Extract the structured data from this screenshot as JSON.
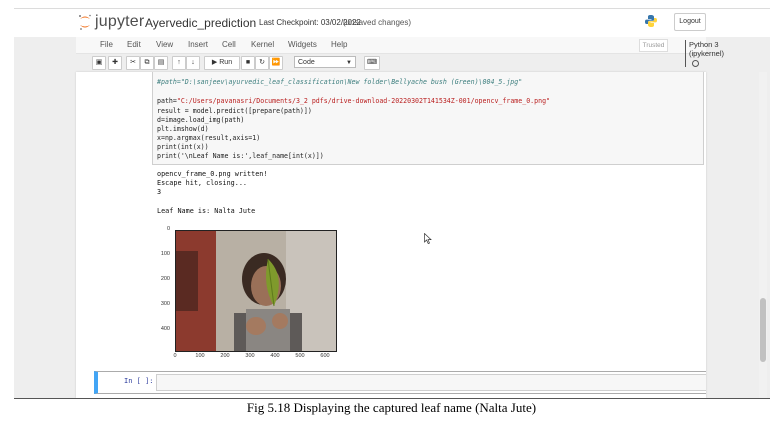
{
  "header": {
    "logo_text": "jupyter",
    "notebook_name": "Ayervedic_prediction",
    "checkpoint": "Last Checkpoint: 03/02/2022",
    "unsaved": "(unsaved changes)",
    "logout_label": "Logout"
  },
  "menu": {
    "items": [
      "File",
      "Edit",
      "View",
      "Insert",
      "Cell",
      "Kernel",
      "Widgets",
      "Help"
    ],
    "trusted": "Trusted",
    "kernel": "Python 3 (ipykernel)"
  },
  "toolbar": {
    "run_label": "Run",
    "cell_type": "Code",
    "icons": [
      "save-icon",
      "add-icon",
      "cut-icon",
      "copy-icon",
      "paste-icon",
      "move-up-icon",
      "move-down-icon",
      "run-icon",
      "stop-icon",
      "restart-icon",
      "fast-forward-icon",
      "keyboard-icon"
    ]
  },
  "code_cell": {
    "lines": [
      "#path=\"D:\\sanjeev\\ayurvedic_leaf_classification\\New folder\\Bellyache bush (Green)\\004_5.jpg\"",
      "",
      "path=\"C:/Users/pavanasri/Documents/3_2 pdfs/drive-download-20220302T141534Z-001/opencv_frame_0.png\"",
      "result = model.predict([prepare(path)])",
      "d=image.load_img(path)",
      "plt.imshow(d)",
      "x=np.argmax(result,axis=1)",
      "print(int(x))",
      "print('\\nLeaf Name is:',leaf_name[int(x)])"
    ]
  },
  "output": {
    "lines": [
      "opencv_frame_0.png written!",
      "Escape hit, closing...",
      "3",
      "",
      "Leaf Name is: Nalta Jute"
    ]
  },
  "plot": {
    "y_ticks": [
      "0",
      "100",
      "200",
      "300",
      "400"
    ],
    "x_ticks": [
      "0",
      "100",
      "200",
      "300",
      "400",
      "500",
      "600"
    ]
  },
  "next_cell": {
    "prompt": "In [ ]:"
  },
  "caption": "Fig 5.18 Displaying the captured leaf name (Nalta Jute)",
  "colors": {
    "accent": "#42a5f5",
    "jupyter_orange": "#f37726",
    "string": "#ba2121",
    "comment": "#408080",
    "builtin": "#008000"
  }
}
